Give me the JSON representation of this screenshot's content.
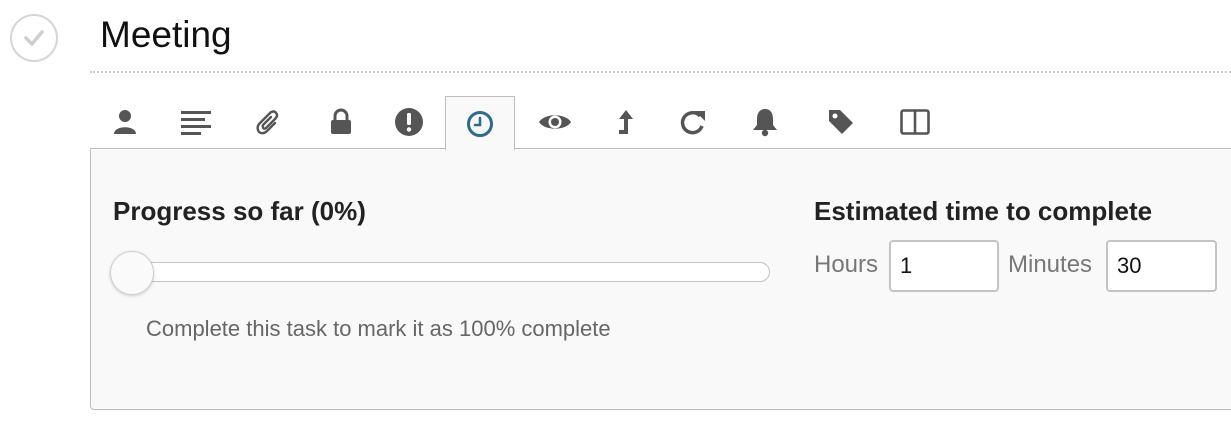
{
  "task": {
    "title": "Meeting",
    "completed": false
  },
  "toolbar": {
    "tabs": [
      {
        "id": "assignee",
        "icon": "user-icon"
      },
      {
        "id": "notes",
        "icon": "notes-icon"
      },
      {
        "id": "attachments",
        "icon": "paperclip-icon"
      },
      {
        "id": "privacy",
        "icon": "lock-icon"
      },
      {
        "id": "priority",
        "icon": "exclamation-icon"
      },
      {
        "id": "time",
        "icon": "clock-icon",
        "active": true
      },
      {
        "id": "followers",
        "icon": "eye-icon"
      },
      {
        "id": "dependencies",
        "icon": "arrow-up-icon"
      },
      {
        "id": "repeat",
        "icon": "redo-icon"
      },
      {
        "id": "reminders",
        "icon": "bell-icon"
      },
      {
        "id": "tags",
        "icon": "tag-icon"
      },
      {
        "id": "layout",
        "icon": "columns-icon"
      }
    ]
  },
  "progress": {
    "heading": "Progress so far (0%)",
    "value": 0,
    "help_text": "Complete this task to mark it as 100% complete"
  },
  "estimate": {
    "heading": "Estimated time to complete",
    "hours_label": "Hours",
    "hours_value": "1",
    "minutes_label": "Minutes",
    "minutes_value": "30"
  },
  "colors": {
    "icon": "#555555",
    "active_icon": "#2e6a8a",
    "panel_bg": "#f9f9f9",
    "border": "#bdbdbd"
  }
}
